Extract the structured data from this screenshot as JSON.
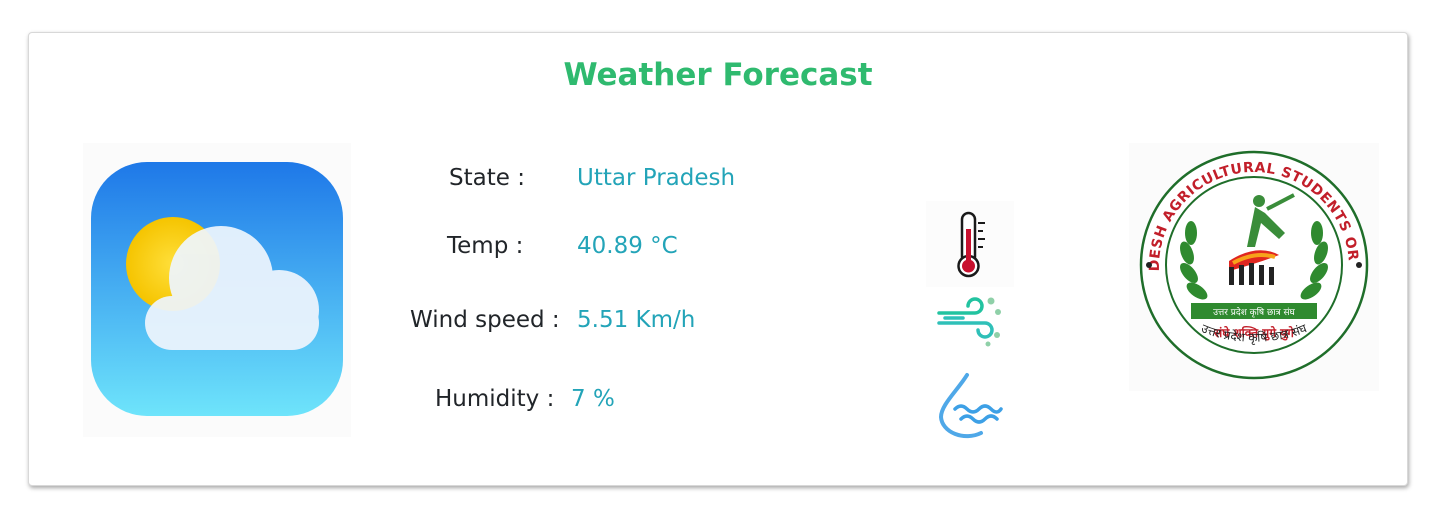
{
  "header": {
    "title": "Weather Forecast"
  },
  "weather": {
    "state_label": "State :",
    "state_value": "Uttar Pradesh",
    "temp_label": "Temp :",
    "temp_value": "40.89 °C",
    "wind_label": "Wind speed :",
    "wind_value": "5.51 Km/h",
    "humidity_label": "Humidity :",
    "humidity_value": "7 %"
  },
  "icons": {
    "weather_app": "weather-app-icon",
    "temperature": "thermometer-icon",
    "wind": "wind-icon",
    "humidity": "humidity-drop-icon",
    "logo": "organization-logo"
  },
  "logo": {
    "outer_text": "UTTAR PRADESH AGRICULTURAL STUDENTS ORGANIZATION",
    "inner_ribbon": "उत्तर प्रदेश कृषि छात्र संघ",
    "motto": "संघे शक्ति युगे युगे",
    "bottom_text": "उत्तर प्रदेश कृषि छात्र संघ"
  },
  "colors": {
    "title": "#2fba6f",
    "value": "#23a4b8",
    "label": "#212529"
  }
}
